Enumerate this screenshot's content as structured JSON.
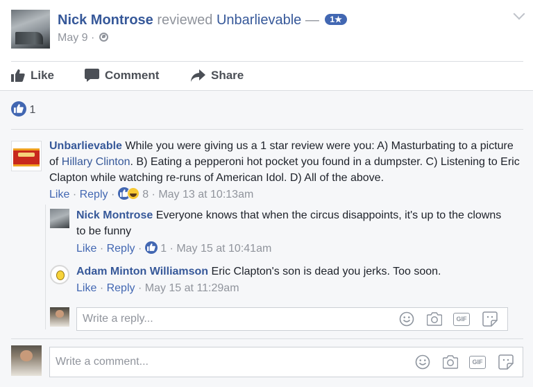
{
  "post": {
    "author": "Nick Montrose",
    "verb": "reviewed",
    "page": "Unbarlievable",
    "dash": "—",
    "rating": "1★",
    "date": "May 9",
    "meta_sep": "·"
  },
  "actions": {
    "like": "Like",
    "comment": "Comment",
    "share": "Share"
  },
  "reactions": {
    "count": "1"
  },
  "comments": [
    {
      "author": "Unbarlievable",
      "text_before_link": "While you were giving us a 1 star review were you: A) Masturbating to a picture of ",
      "link": "Hillary Clinton",
      "text_after_link": ". B) Eating a pepperoni hot pocket you found in a dumpster. C) Listening to Eric Clapton while watching re-runs of American Idol. D) All of the above.",
      "like": "Like",
      "reply": "Reply",
      "sep": "·",
      "reaction_count": "8",
      "time": "May 13 at 10:13am"
    },
    {
      "author": "Nick Montrose",
      "text": "Everyone knows that when the circus disappoints, it's up to the clowns to be funny",
      "like": "Like",
      "reply": "Reply",
      "sep": "·",
      "reaction_count": "1",
      "time": "May 15 at 10:41am"
    },
    {
      "author": "Adam Minton Williamson",
      "text": "Eric Clapton's son is dead you jerks. Too soon.",
      "like": "Like",
      "reply": "Reply",
      "sep": "·",
      "time": "May 15 at 11:29am"
    }
  ],
  "reply_box": {
    "placeholder": "Write a reply..."
  },
  "comment_box": {
    "placeholder": "Write a comment..."
  },
  "icons": {
    "emoji": "smiley-icon",
    "camera": "camera-icon",
    "gif": "gif-icon",
    "sticker": "sticker-icon",
    "gif_label": "GIF"
  },
  "colors": {
    "link": "#365899",
    "accent": "#4267b2",
    "muted": "#90949c",
    "comment_bg": "#f6f7f9"
  }
}
